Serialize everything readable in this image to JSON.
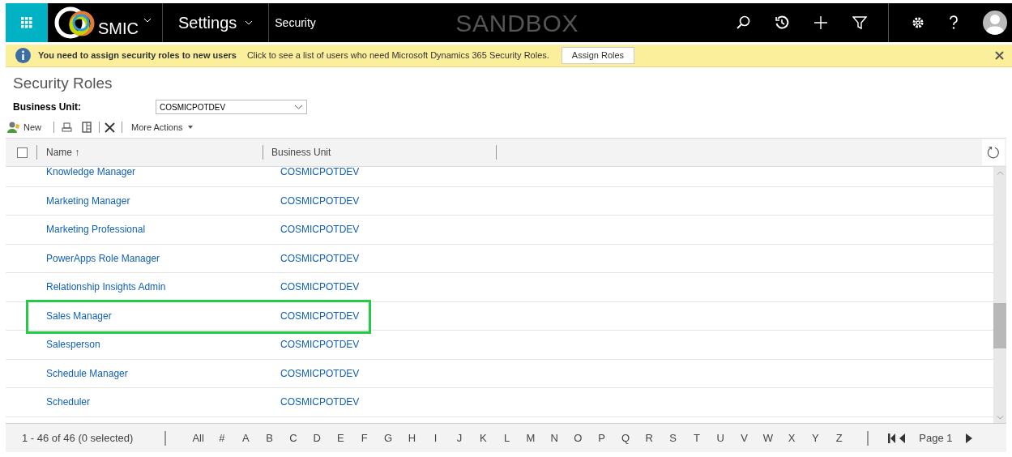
{
  "top_bar": {
    "app_name": "SMIC",
    "area": "Settings",
    "section": "Security",
    "environment": "SANDBOX"
  },
  "notification": {
    "title": "You need to assign security roles to new users",
    "message": "Click to see a list of users who need Microsoft Dynamics 365 Security Roles.",
    "button": "Assign Roles"
  },
  "page_title": "Security Roles",
  "business_unit": {
    "label": "Business Unit:",
    "value": "COSMICPOTDEV"
  },
  "toolbar": {
    "new": "New",
    "more_actions": "More Actions"
  },
  "table": {
    "select_all_checked": false,
    "columns": [
      "Name ↑",
      "Business Unit"
    ],
    "rows": [
      {
        "name": "Knowledge Manager",
        "business_unit": "COSMICPOTDEV",
        "highlighted": false
      },
      {
        "name": "Marketing Manager",
        "business_unit": "COSMICPOTDEV",
        "highlighted": false
      },
      {
        "name": "Marketing Professional",
        "business_unit": "COSMICPOTDEV",
        "highlighted": false
      },
      {
        "name": "PowerApps Role Manager",
        "business_unit": "COSMICPOTDEV",
        "highlighted": false
      },
      {
        "name": "Relationship Insights Admin",
        "business_unit": "COSMICPOTDEV",
        "highlighted": false
      },
      {
        "name": "Sales Manager",
        "business_unit": "COSMICPOTDEV",
        "highlighted": true
      },
      {
        "name": "Salesperson",
        "business_unit": "COSMICPOTDEV",
        "highlighted": false
      },
      {
        "name": "Schedule Manager",
        "business_unit": "COSMICPOTDEV",
        "highlighted": false
      },
      {
        "name": "Scheduler",
        "business_unit": "COSMICPOTDEV",
        "highlighted": false
      }
    ]
  },
  "footer": {
    "count": "1 - 46 of 46 (0 selected)",
    "letters": [
      "All",
      "#",
      "A",
      "B",
      "C",
      "D",
      "E",
      "F",
      "G",
      "H",
      "I",
      "J",
      "K",
      "L",
      "M",
      "N",
      "O",
      "P",
      "Q",
      "R",
      "S",
      "T",
      "U",
      "V",
      "W",
      "X",
      "Y",
      "Z"
    ],
    "page": "Page 1"
  }
}
